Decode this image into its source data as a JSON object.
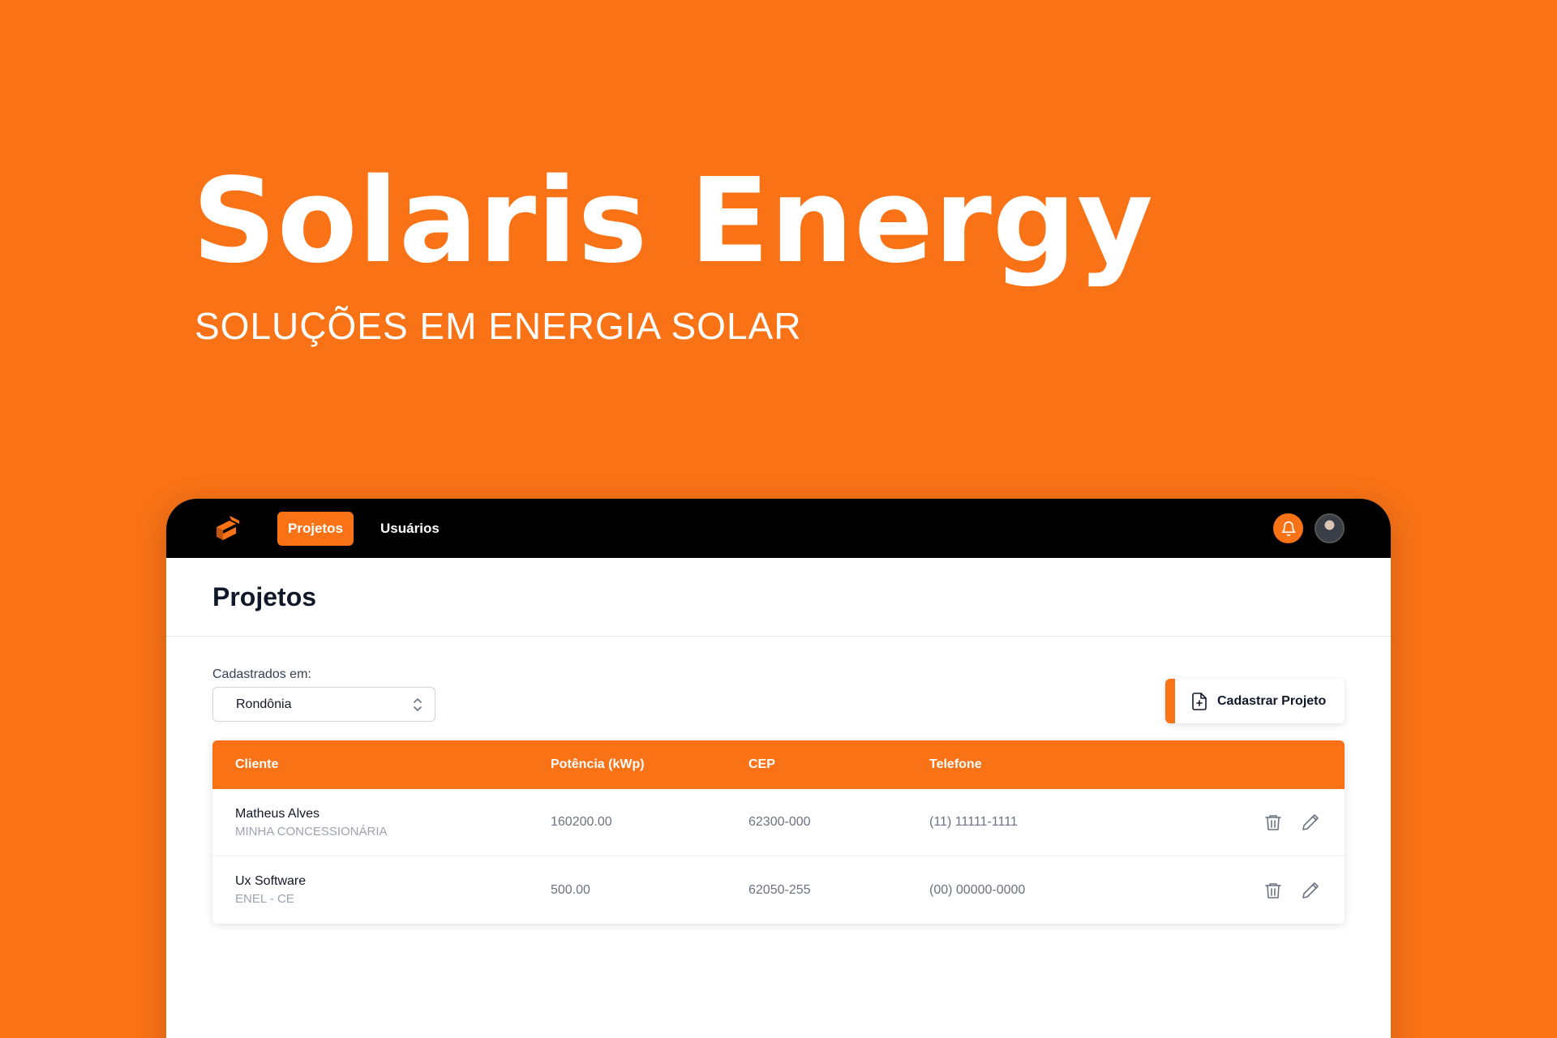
{
  "hero": {
    "title": "Solaris Energy",
    "subtitle": "SOLUÇÕES EM ENERGIA SOLAR"
  },
  "colors": {
    "brand": "#F97316",
    "topbar": "#000000"
  },
  "nav": {
    "items": [
      {
        "label": "Projetos",
        "active": true
      },
      {
        "label": "Usuários",
        "active": false
      }
    ]
  },
  "page": {
    "title": "Projetos"
  },
  "filter": {
    "label": "Cadastrados em:",
    "selected": "Rondônia"
  },
  "actions": {
    "add_project_label": "Cadastrar Projeto"
  },
  "table": {
    "columns": [
      "Cliente",
      "Potência (kWp)",
      "CEP",
      "Telefone"
    ],
    "rows": [
      {
        "client": "Matheus Alves",
        "concessionaire": "MINHA CONCESSIONÁRIA",
        "power": "160200.00",
        "cep": "62300-000",
        "phone": "(11) 11111-1111"
      },
      {
        "client": "Ux Software",
        "concessionaire": "ENEL - CE",
        "power": "500.00",
        "cep": "62050-255",
        "phone": "(00) 00000-0000"
      }
    ]
  },
  "icons": {
    "logo": "solaris-logo-icon",
    "bell": "bell-icon",
    "delete": "trash-icon",
    "edit": "pencil-icon",
    "add": "file-plus-icon",
    "select": "chevron-up-down-icon"
  }
}
